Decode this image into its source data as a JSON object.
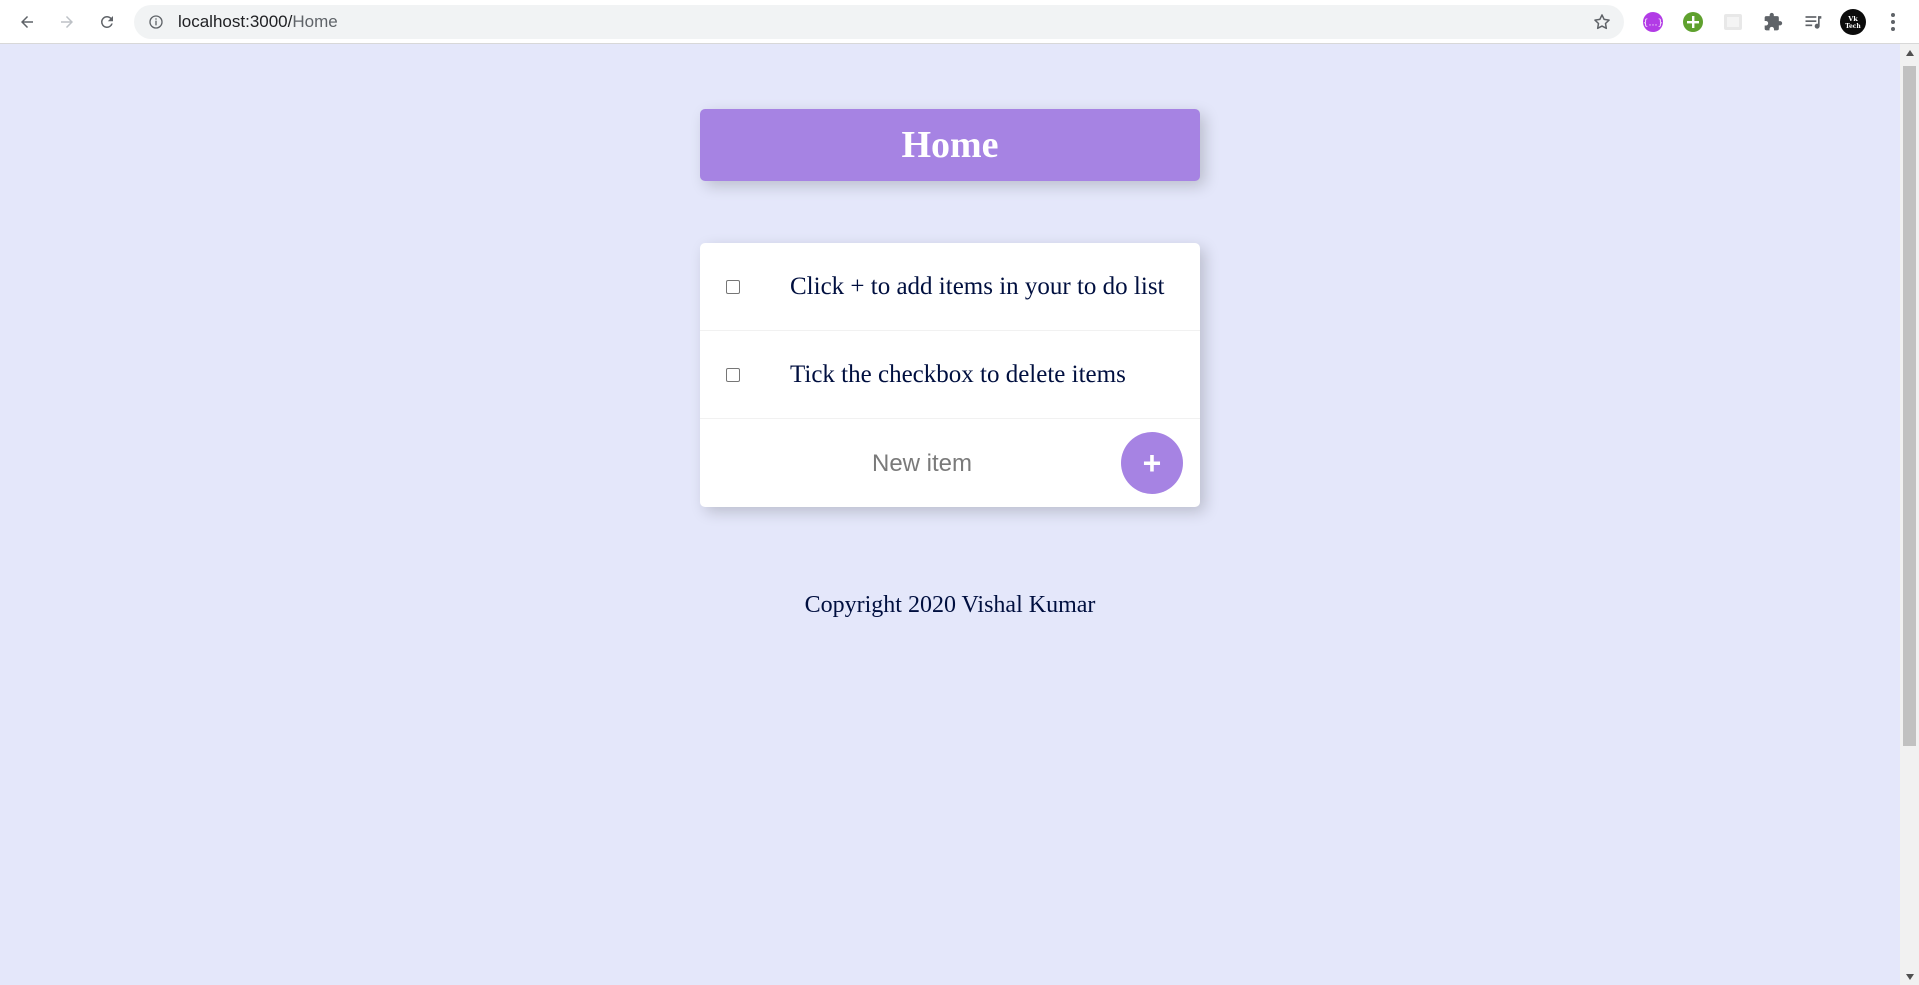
{
  "browser": {
    "url_host": "localhost:3000/",
    "url_path": "Home",
    "icons": {
      "back": "back-arrow-icon",
      "forward": "forward-arrow-icon",
      "reload": "reload-icon",
      "info": "info-icon",
      "bookmark": "star-icon",
      "extensions": "puzzle-icon",
      "reading_list": "reading-list-icon",
      "profile": "profile-avatar",
      "menu": "kebab-menu-icon"
    },
    "profile_initials": "Vk Tech"
  },
  "page": {
    "heading": "Home",
    "items": [
      {
        "label": "Click + to add items in your to do list",
        "checked": false
      },
      {
        "label": "Tick the checkbox to delete items",
        "checked": false
      }
    ],
    "new_item": {
      "placeholder": "New item",
      "value": "",
      "add_label": "+"
    },
    "footer": "Copyright 2020 Vishal Kumar"
  },
  "colors": {
    "page_background": "#E4E7FA",
    "accent": "#A683E3",
    "text": "#000F3F",
    "card": "#FFFFFF"
  }
}
